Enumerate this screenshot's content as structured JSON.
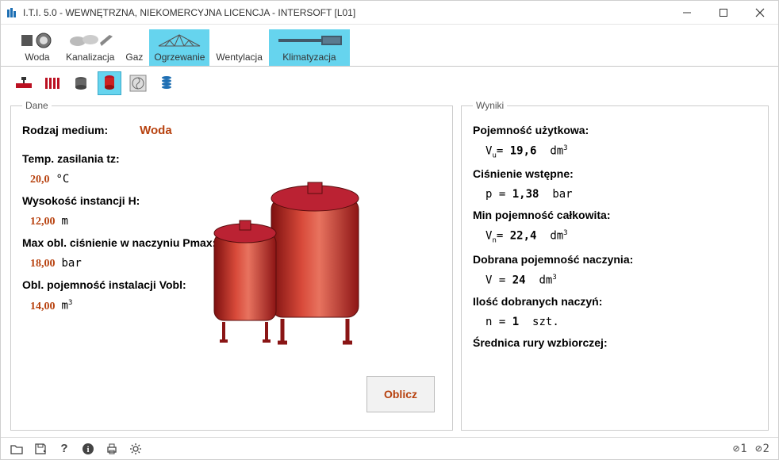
{
  "window": {
    "title": "I.T.I. 5.0 - WEWNĘTRZNA, NIEKOMERCYJNA LICENCJA - INTERSOFT [L01]"
  },
  "maintabs": {
    "items": [
      {
        "label": "Woda"
      },
      {
        "label": "Kanalizacja"
      },
      {
        "label": "Gaz"
      },
      {
        "label": "Ogrzewanie"
      },
      {
        "label": "Wentylacja"
      },
      {
        "label": "Klimatyzacja"
      }
    ],
    "activeIndex": 3
  },
  "subtoolbarActiveIndex": 3,
  "panels": {
    "left_title": "Dane",
    "right_title": "Wyniki"
  },
  "dane": {
    "medium_label": "Rodzaj medium:",
    "medium_value": "Woda",
    "tz_label": "Temp. zasilania tz:",
    "tz_value": "20,0",
    "tz_unit": "°C",
    "h_label": "Wysokość instancji H:",
    "h_value": "12,00",
    "h_unit": "m",
    "pmax_label": "Max obl. ciśnienie w naczyniu Pmax:",
    "pmax_value": "18,00",
    "pmax_unit": "bar",
    "vobl_label": "Obl. pojemność instalacji Vobl:",
    "vobl_value": "14,00",
    "vobl_unit": "m",
    "vobl_unit_sup": "3",
    "calc_button": "Oblicz"
  },
  "wyniki": {
    "vu_label": "Pojemność użytkowa:",
    "vu_sym": "V",
    "vu_sub": "u",
    "vu_eq": "=",
    "vu_val": "19,6",
    "vu_unit": "dm",
    "vu_sup": "3",
    "pw_label": "Ciśnienie wstępne:",
    "pw_sym": "p",
    "pw_eq": "=",
    "pw_val": "1,38",
    "pw_unit": "bar",
    "vn_label": "Min pojemność całkowita:",
    "vn_sym": "V",
    "vn_sub": "n",
    "vn_eq": "=",
    "vn_val": "22,4",
    "vn_unit": "dm",
    "vn_sup": "3",
    "vd_label": "Dobrana pojemność naczynia:",
    "vd_sym": "V",
    "vd_eq": "=",
    "vd_val": "24",
    "vd_unit": "dm",
    "vd_sup": "3",
    "n_label": "Ilość dobranych naczyń:",
    "n_sym": "n",
    "n_eq": "=",
    "n_val": "1",
    "n_unit": "szt.",
    "dr_label": "Średnica rury wzbiorczej:"
  },
  "statusbar": {
    "right": "⊘1 ⊘2"
  }
}
